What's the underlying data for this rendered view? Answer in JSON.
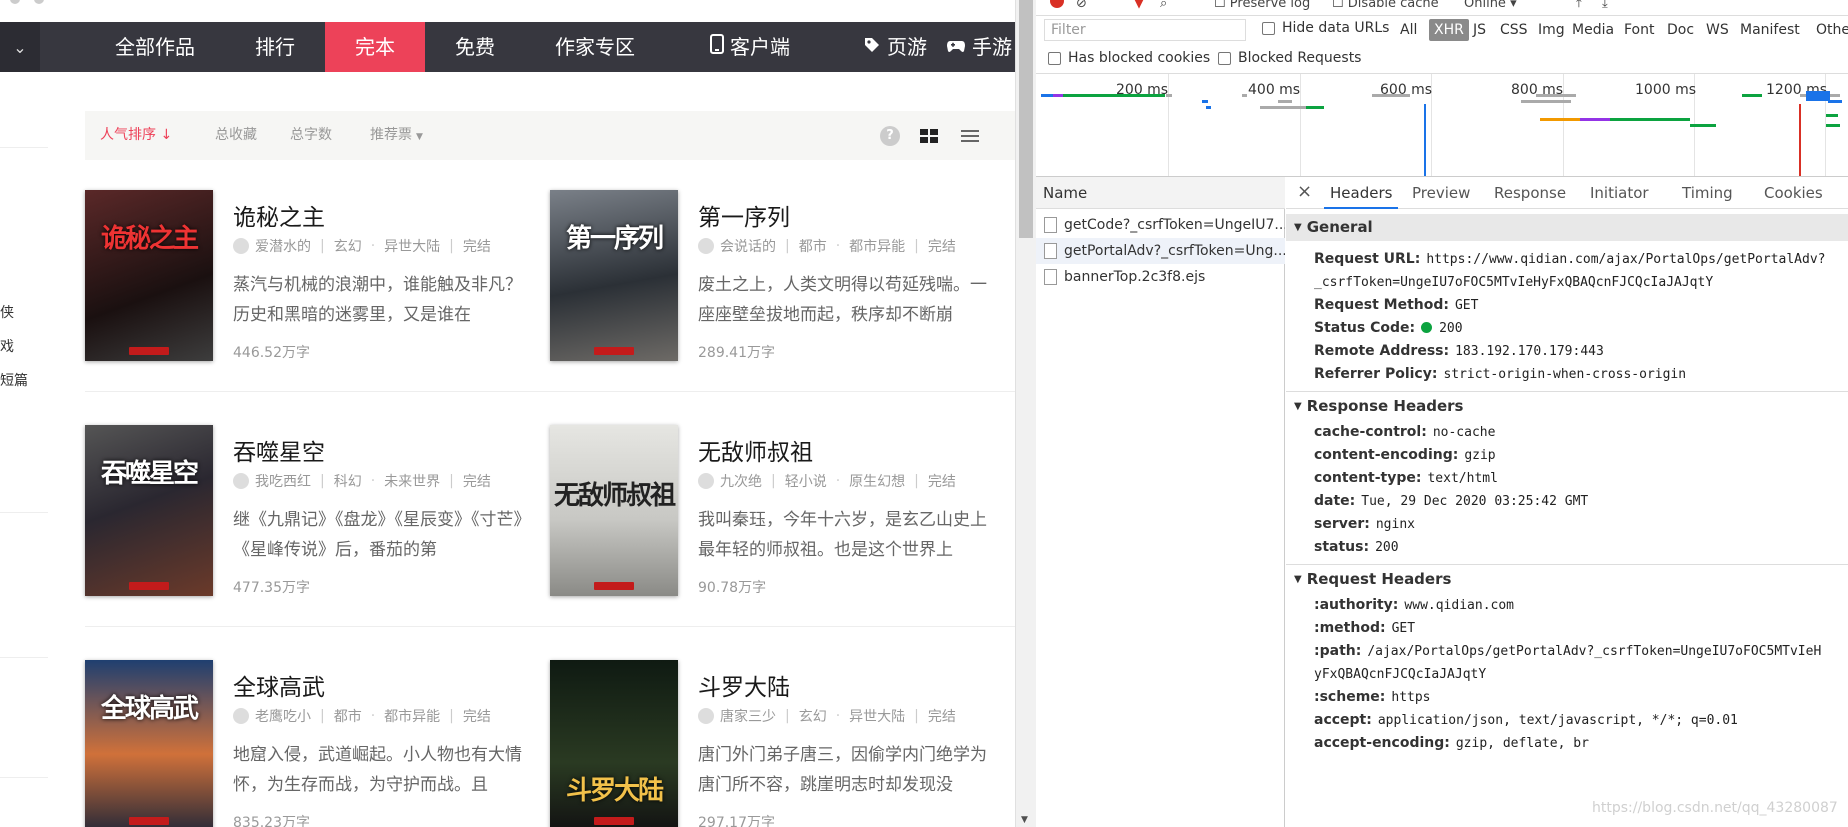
{
  "site": {
    "nav_left_icon": "chevron-down",
    "nav": [
      {
        "label": "全部作品"
      },
      {
        "label": "排行"
      },
      {
        "label": "完本",
        "active": true
      },
      {
        "label": "免费"
      },
      {
        "label": "作家专区"
      },
      {
        "label": "客户端",
        "icon": "phone"
      },
      {
        "label": "页游",
        "icon": "tag"
      },
      {
        "label": "手游",
        "icon": "gamepad"
      }
    ],
    "sidebar_items": [
      "侠",
      "戏",
      "短篇"
    ],
    "filters": {
      "popularity": "人气排序 ↓",
      "favorites": "总收藏",
      "wordcount": "总字数",
      "recommend": "推荐票"
    },
    "books": [
      {
        "title": "诡秘之主",
        "author": "爱潜水的",
        "genre": "玄幻",
        "sub": "异世大陆",
        "status": "完结",
        "desc": "蒸汽与机械的浪潮中，谁能触及非凡？历史和黑暗的迷雾里，又是谁在",
        "count": "446.52万字",
        "cover_text": "诡秘之主",
        "cover_bg": "#3a2020"
      },
      {
        "title": "第一序列",
        "author": "会说话的",
        "genre": "都市",
        "sub": "都市异能",
        "status": "完结",
        "desc": "废土之上，人类文明得以苟延残喘。一座座壁垒拔地而起，秩序却不断崩",
        "count": "289.41万字",
        "cover_text": "第一序列",
        "cover_bg": "#4a5058"
      },
      {
        "title": "吞噬星空",
        "author": "我吃西红",
        "genre": "科幻",
        "sub": "未来世界",
        "status": "完结",
        "desc": "继《九鼎记》《盘龙》《星辰变》《寸芒》《星峰传说》后，番茄的第",
        "count": "477.35万字",
        "cover_text": "吞噬星空",
        "cover_bg": "#3b3946"
      },
      {
        "title": "无敌师叔祖",
        "author": "九次绝",
        "genre": "轻小说",
        "sub": "原生幻想",
        "status": "完结",
        "desc": "我叫秦珏，今年十六岁，是玄乙山史上最年轻的师叔祖。也是这个世界上",
        "count": "90.78万字",
        "cover_text": "无敌师叔祖",
        "cover_bg": "#d6d6d2"
      },
      {
        "title": "全球高武",
        "author": "老鹰吃小",
        "genre": "都市",
        "sub": "都市异能",
        "status": "完结",
        "desc": "地窟入侵，武道崛起。小人物也有大情怀，为生存而战，为守护而战。且",
        "count": "835.23万字",
        "cover_text": "全球高武",
        "cover_bg": "#2a3b5a"
      },
      {
        "title": "斗罗大陆",
        "author": "唐家三少",
        "genre": "玄幻",
        "sub": "异世大陆",
        "status": "完结",
        "desc": "唐门外门弟子唐三，因偷学内门绝学为唐门所不容，跳崖明志时却发现没",
        "count": "297.17万字",
        "cover_text": "斗罗大陆",
        "cover_bg": "#1d2a1d"
      }
    ]
  },
  "devtools": {
    "toolbar_fragments": [
      "Preserve log",
      "Disable cache",
      "Online"
    ],
    "filter_placeholder": "Filter",
    "hide_data_urls": "Hide data URLs",
    "types": [
      "All",
      "XHR",
      "JS",
      "CSS",
      "Img",
      "Media",
      "Font",
      "Doc",
      "WS",
      "Manifest",
      "Othe"
    ],
    "active_type": "XHR",
    "has_blocked_cookies": "Has blocked cookies",
    "blocked_requests": "Blocked Requests",
    "timeline_labels": [
      "200 ms",
      "400 ms",
      "600 ms",
      "800 ms",
      "1000 ms",
      "1200 ms"
    ],
    "name_header": "Name",
    "requests": [
      "getCode?_csrfToken=UngeIU7...",
      "getPortalAdv?_csrfToken=Ung...",
      "bannerTop.2c3f8.ejs"
    ],
    "tabs": [
      "Headers",
      "Preview",
      "Response",
      "Initiator",
      "Timing",
      "Cookies"
    ],
    "active_tab": "Headers",
    "general": {
      "title": "General",
      "request_url_key": "Request URL:",
      "request_url_1": "https://www.qidian.com/ajax/PortalOps/getPortalAdv?",
      "request_url_2": "_csrfToken=UngeIU7oFOC5MTvIeHyFxQBAQcnFJCQcIaJAJqtY",
      "method_key": "Request Method:",
      "method": "GET",
      "status_key": "Status Code:",
      "status": "200",
      "remote_key": "Remote Address:",
      "remote": "183.192.170.179:443",
      "referrer_key": "Referrer Policy:",
      "referrer": "strict-origin-when-cross-origin"
    },
    "response_headers": {
      "title": "Response Headers",
      "items": [
        {
          "k": "cache-control:",
          "v": "no-cache"
        },
        {
          "k": "content-encoding:",
          "v": "gzip"
        },
        {
          "k": "content-type:",
          "v": "text/html"
        },
        {
          "k": "date:",
          "v": "Tue, 29 Dec 2020 03:25:42 GMT"
        },
        {
          "k": "server:",
          "v": "nginx"
        },
        {
          "k": "status:",
          "v": "200"
        }
      ]
    },
    "request_headers": {
      "title": "Request Headers",
      "authority_k": ":authority:",
      "authority_v": "www.qidian.com",
      "method_k": ":method:",
      "method_v": "GET",
      "path_k": ":path:",
      "path_v1": "/ajax/PortalOps/getPortalAdv?_csrfToken=UngeIU7oFOC5MTvIeH",
      "path_v2": "yFxQBAQcnFJCQcIaJAJqtY",
      "scheme_k": ":scheme:",
      "scheme_v": "https",
      "accept_k": "accept:",
      "accept_v": "application/json, text/javascript, */*; q=0.01",
      "accept_enc_k": "accept-encoding:",
      "accept_enc_v": "gzip, deflate, br"
    },
    "watermark": "https://blog.csdn.net/qq_43280087"
  }
}
